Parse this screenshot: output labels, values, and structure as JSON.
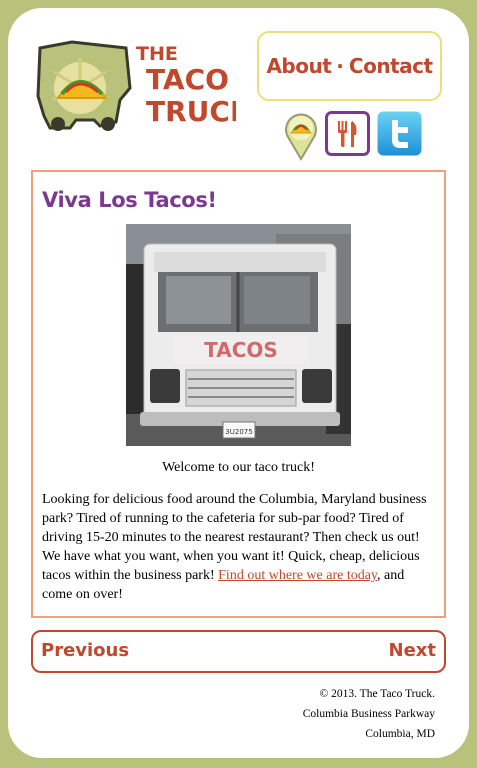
{
  "brand": {
    "line1": "THE",
    "line2": "TACO",
    "line3": "TRUCK"
  },
  "nav": {
    "about": "About",
    "separator": "·",
    "contact": "Contact"
  },
  "icons": [
    "location-taco-icon",
    "fork-knife-icon",
    "twitter-icon"
  ],
  "main": {
    "title": "Viva Los Tacos!",
    "image_sign": "TACOS",
    "plate": "3U2075",
    "caption": "Welcome to our taco truck!",
    "paragraph_start": "Looking for delicious food around the Columbia, Maryland business park? Tired of running to the cafeteria for sub-par food? Tired of driving 15-20 minutes to the nearest restaurant? Then check us out! We have what you want, when you want it! Quick, cheap, delicious tacos within the business park! ",
    "link": "Find out where we are today",
    "paragraph_end": ", and come on over!"
  },
  "pager": {
    "previous": "Previous",
    "next": "Next"
  },
  "footer": {
    "copyright": "© 2013. The Taco Truck.",
    "street": "Columbia Business Parkway",
    "city": "Columbia, MD"
  },
  "colors": {
    "background": "#b9c27a",
    "accent": "#c0482c",
    "title": "#7b3a8f",
    "nav_border": "#e8e07a",
    "content_border": "#f0a07a"
  }
}
